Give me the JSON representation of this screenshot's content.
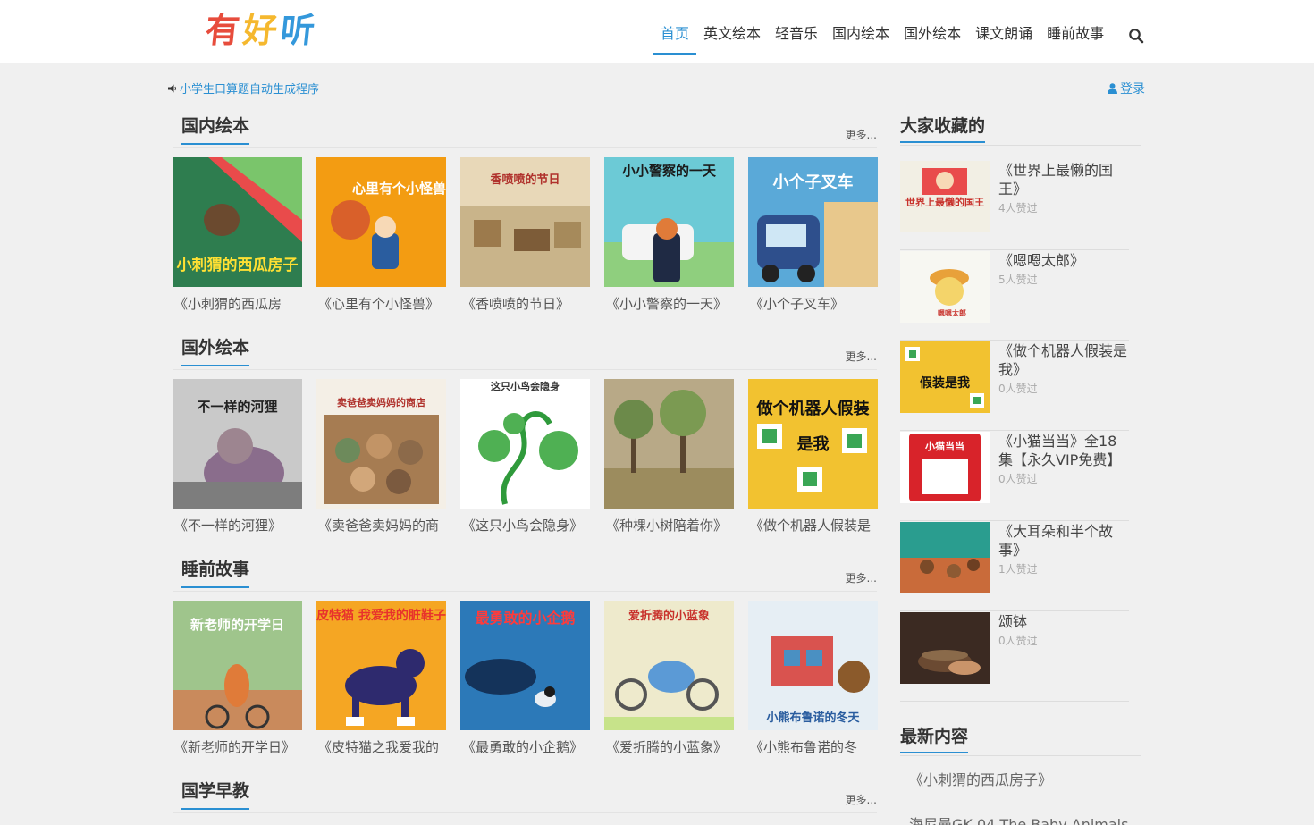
{
  "header": {
    "logo_chars": [
      "有",
      "好",
      "听"
    ],
    "logo_colors": [
      "#e74c3c",
      "#f5b82e",
      "#3498db"
    ],
    "nav": [
      "首页",
      "英文绘本",
      "轻音乐",
      "国内绘本",
      "国外绘本",
      "课文朗诵",
      "睡前故事"
    ],
    "active_nav": "首页",
    "search_icon": "search-icon"
  },
  "notice": {
    "text": "小学生口算题自动生成程序",
    "icon": "speaker-icon"
  },
  "login": {
    "label": "登录",
    "icon": "user-icon"
  },
  "accent_color": "#2a8fd2",
  "sections": [
    {
      "title": "国内绘本",
      "more": "更多...",
      "books": [
        {
          "title": "《小刺猬的西瓜房",
          "cover_text": "小刺猬的西瓜房子",
          "cover_color": "#2e7d4f"
        },
        {
          "title": "《心里有个小怪兽》",
          "cover_text": "心里有个小怪兽",
          "cover_color": "#f39c12"
        },
        {
          "title": "《香喷喷的节日》",
          "cover_text": "香喷喷的节日",
          "cover_color": "#e8d8b8"
        },
        {
          "title": "《小小警察的一天》",
          "cover_text": "小小警察的一天",
          "cover_color": "#6ccad6"
        },
        {
          "title": "《小个子叉车》",
          "cover_text": "小个子叉车",
          "cover_color": "#5aa9d8"
        }
      ]
    },
    {
      "title": "国外绘本",
      "more": "更多...",
      "books": [
        {
          "title": "《不一样的河狸》",
          "cover_text": "不一样的河狸",
          "cover_color": "#c9c9c9"
        },
        {
          "title": "《卖爸爸卖妈妈的商",
          "cover_text": "卖爸爸卖妈妈的商店",
          "cover_color": "#b38a5e"
        },
        {
          "title": "《这只小鸟会隐身》",
          "cover_text": "这只小鸟会隐身",
          "cover_color": "#ffffff"
        },
        {
          "title": "《种棵小树陪着你》",
          "cover_text": "",
          "cover_color": "#b8a987"
        },
        {
          "title": "《做个机器人假装是",
          "cover_text": "做个机器人假装是我",
          "cover_color": "#f2c230"
        }
      ]
    },
    {
      "title": "睡前故事",
      "more": "更多...",
      "books": [
        {
          "title": "《新老师的开学日》",
          "cover_text": "新老师的开学日",
          "cover_color": "#9fc58c"
        },
        {
          "title": "《皮特猫之我爱我的",
          "cover_text": "皮特猫 我爱我的脏鞋子",
          "cover_color": "#f5a623"
        },
        {
          "title": "《最勇敢的小企鹅》",
          "cover_text": "最勇敢的小企鹅",
          "cover_color": "#2c79b8"
        },
        {
          "title": "《爱折腾的小蓝象》",
          "cover_text": "爱折腾的小蓝象",
          "cover_color": "#eeeacc"
        },
        {
          "title": "《小熊布鲁诺的冬",
          "cover_text": "小熊布鲁诺的冬天",
          "cover_color": "#e6eef4"
        }
      ]
    },
    {
      "title": "国学早教",
      "more": "更多...",
      "books": []
    }
  ],
  "sidebar": {
    "favorites_title": "大家收藏的",
    "favorites": [
      {
        "name": "《世界上最懒的国王》",
        "likes": "4人赞过",
        "thumb_color": "#f2efe4",
        "thumb_text": "世界上最懒的国王"
      },
      {
        "name": "《嗯嗯太郎》",
        "likes": "5人赞过",
        "thumb_color": "#f7f7f2",
        "thumb_text": "嗯嗯太郎"
      },
      {
        "name": "《做个机器人假装是我》",
        "likes": "0人赞过",
        "thumb_color": "#f2c230",
        "thumb_text": "假装是我"
      },
      {
        "name": "《小猫当当》全18集【永久VIP免费】",
        "likes": "0人赞过",
        "thumb_color": "#d8232a",
        "thumb_text": "小猫当当"
      },
      {
        "name": "《大耳朵和半个故事》",
        "likes": "1人赞过",
        "thumb_color": "#2a9d8f",
        "thumb_text": ""
      },
      {
        "name": "颂钵",
        "likes": "0人赞过",
        "thumb_color": "#3b2a22",
        "thumb_text": ""
      }
    ],
    "latest_title": "最新内容",
    "latest": [
      "《小刺猬的西瓜房子》",
      "海尼曼GK 04 The Baby Animals"
    ]
  }
}
